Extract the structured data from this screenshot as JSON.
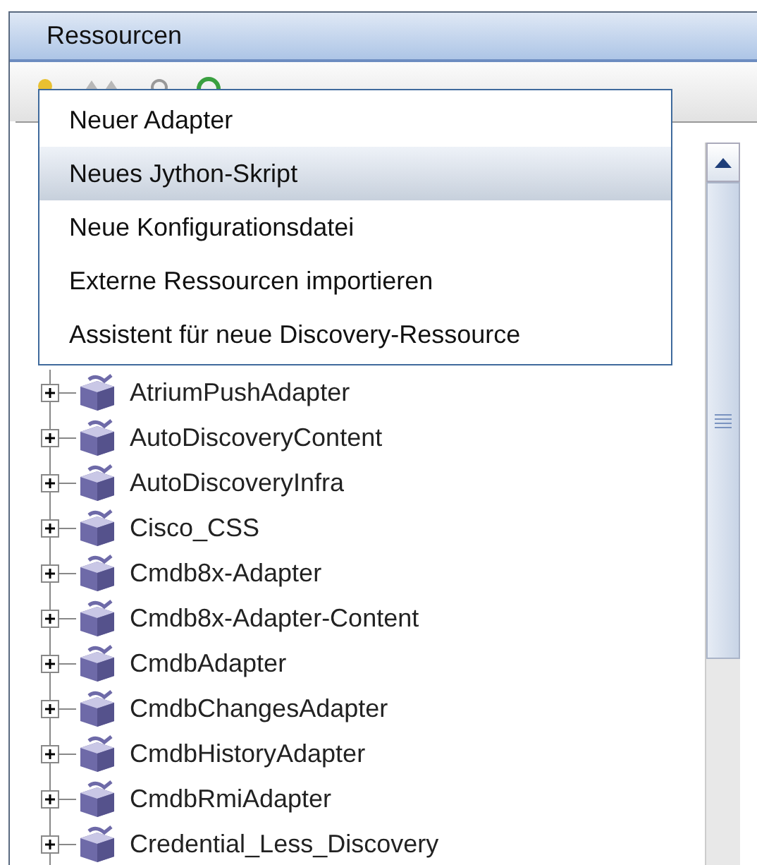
{
  "panel": {
    "title": "Ressourcen"
  },
  "menu": {
    "items": [
      {
        "label": "Neuer Adapter",
        "selected": false
      },
      {
        "label": "Neues Jython-Skript",
        "selected": true
      },
      {
        "label": "Neue Konfigurationsdatei",
        "selected": false
      },
      {
        "label": "Externe Ressourcen importieren",
        "selected": false
      },
      {
        "label": "Assistent für neue Discovery-Ressource",
        "selected": false
      }
    ]
  },
  "tree": {
    "items": [
      {
        "label": "AtriumPushAdapter",
        "expanded": false
      },
      {
        "label": "AutoDiscoveryContent",
        "expanded": false
      },
      {
        "label": "AutoDiscoveryInfra",
        "expanded": false
      },
      {
        "label": "Cisco_CSS",
        "expanded": false
      },
      {
        "label": "Cmdb8x-Adapter",
        "expanded": false
      },
      {
        "label": "Cmdb8x-Adapter-Content",
        "expanded": false
      },
      {
        "label": "CmdbAdapter",
        "expanded": false
      },
      {
        "label": "CmdbChangesAdapter",
        "expanded": false
      },
      {
        "label": "CmdbHistoryAdapter",
        "expanded": false
      },
      {
        "label": "CmdbRmiAdapter",
        "expanded": false
      },
      {
        "label": "Credential_Less_Discovery",
        "expanded": false
      }
    ]
  }
}
